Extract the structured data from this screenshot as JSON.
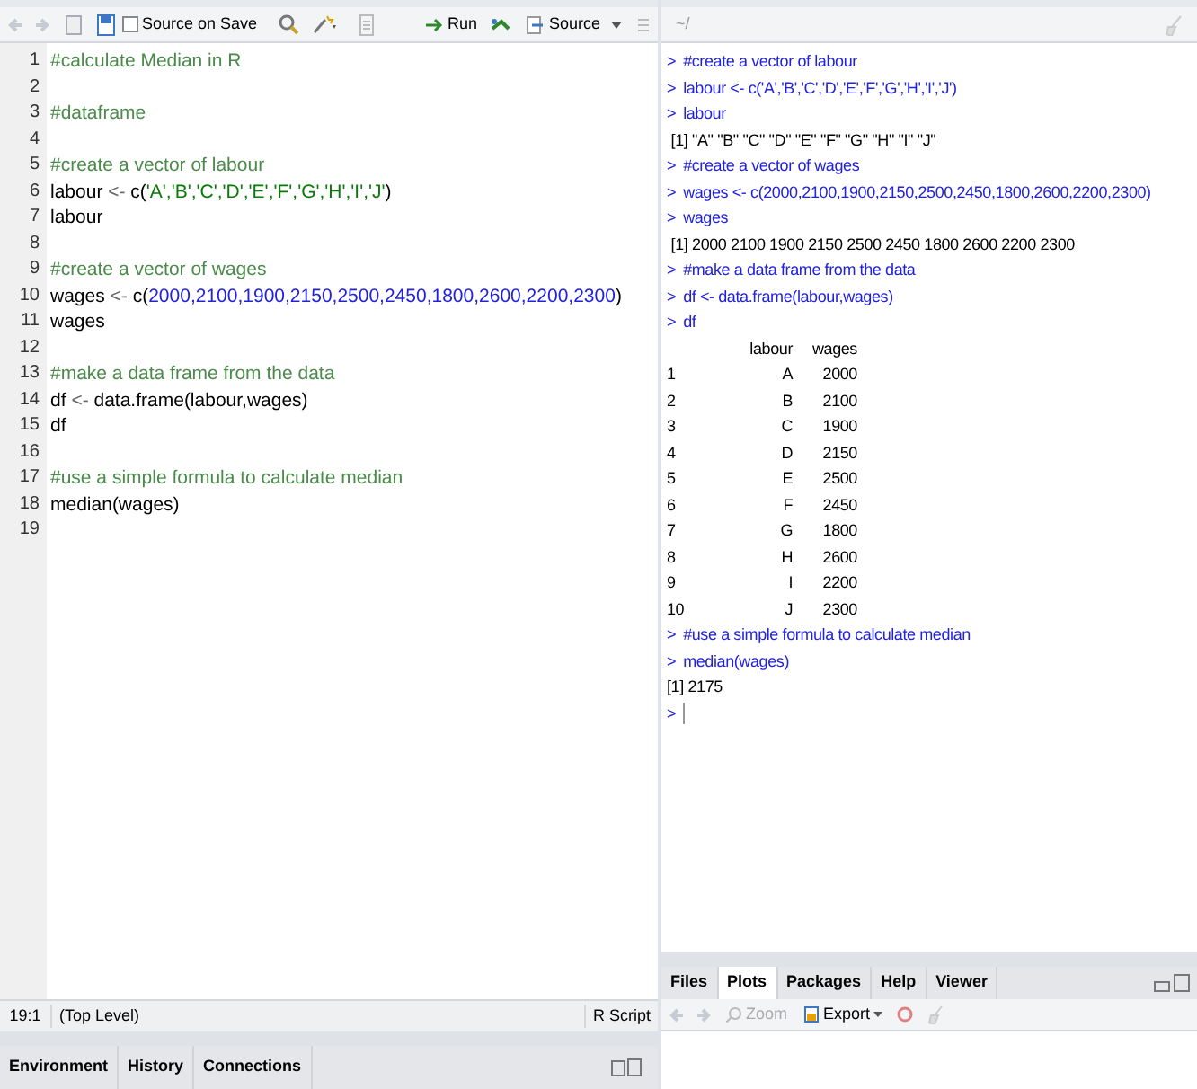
{
  "editor": {
    "toolbar": {
      "source_on_save": {
        "label": "Source on Save",
        "checked": false
      },
      "run": "Run",
      "source": "Source"
    },
    "lines": [
      {
        "number": "1",
        "tokens": [
          {
            "kind": "comment",
            "text": "#calculate Median in R"
          }
        ]
      },
      {
        "number": "2"
      },
      {
        "number": "3",
        "tokens": [
          {
            "kind": "comment",
            "text": "#dataframe"
          }
        ]
      },
      {
        "number": "4"
      },
      {
        "number": "5",
        "tokens": [
          {
            "kind": "comment",
            "text": "#create a vector of labour"
          }
        ]
      },
      {
        "number": "6",
        "tokens": [
          {
            "kind": "plain",
            "text": "labour "
          },
          {
            "kind": "operator",
            "text": "<-"
          },
          {
            "kind": "plain",
            "text": " c("
          },
          {
            "kind": "string",
            "text": "'A','B','C','D','E','F','G','H','I','J'"
          },
          {
            "kind": "plain",
            "text": ")"
          }
        ]
      },
      {
        "number": "7",
        "tokens": [
          {
            "kind": "plain",
            "text": "labour"
          }
        ]
      },
      {
        "number": "8"
      },
      {
        "number": "9",
        "tokens": [
          {
            "kind": "comment",
            "text": "#create a vector of wages"
          }
        ]
      },
      {
        "number": "10",
        "tokens": [
          {
            "kind": "plain",
            "text": "wages "
          },
          {
            "kind": "operator",
            "text": "<-"
          },
          {
            "kind": "plain",
            "text": " c("
          },
          {
            "kind": "number",
            "text": "2000,2100,1900,2150,2500,2450,1800,2600,2200,2300"
          },
          {
            "kind": "plain",
            "text": ")"
          }
        ]
      },
      {
        "number": "11",
        "tokens": [
          {
            "kind": "plain",
            "text": "wages"
          }
        ]
      },
      {
        "number": "12"
      },
      {
        "number": "13",
        "tokens": [
          {
            "kind": "comment",
            "text": "#make a data frame from the data"
          }
        ]
      },
      {
        "number": "14",
        "tokens": [
          {
            "kind": "plain",
            "text": "df "
          },
          {
            "kind": "operator",
            "text": "<-"
          },
          {
            "kind": "plain",
            "text": " data.frame(labour,wages)"
          }
        ]
      },
      {
        "number": "15",
        "tokens": [
          {
            "kind": "plain",
            "text": "df"
          }
        ]
      },
      {
        "number": "16"
      },
      {
        "number": "17",
        "tokens": [
          {
            "kind": "comment",
            "text": "#use a simple formula to calculate median"
          }
        ]
      },
      {
        "number": "18",
        "tokens": [
          {
            "kind": "plain",
            "text": "median(wages)"
          }
        ]
      },
      {
        "number": "19"
      }
    ],
    "status_bar": {
      "position": "19:1",
      "scope": "(Top Level)",
      "file_type": "R Script"
    }
  },
  "console": {
    "title": "~/",
    "lines": [
      {
        "kind": "input",
        "prompt": ">",
        "text": "#create a vector of labour"
      },
      {
        "kind": "input",
        "prompt": ">",
        "text": "labour <- c('A','B','C','D','E','F','G','H','I','J')"
      },
      {
        "kind": "input",
        "prompt": ">",
        "text": "labour"
      },
      {
        "kind": "output",
        "text": " [1] \"A\" \"B\" \"C\" \"D\" \"E\" \"F\" \"G\" \"H\" \"I\" \"J\""
      },
      {
        "kind": "input",
        "prompt": ">",
        "text": "#create a vector of wages"
      },
      {
        "kind": "input",
        "prompt": ">",
        "text": "wages <- c(2000,2100,1900,2150,2500,2450,1800,2600,2200,2300)"
      },
      {
        "kind": "input",
        "prompt": ">",
        "text": "wages"
      },
      {
        "kind": "output",
        "text": " [1] 2000 2100 1900 2150 2500 2450 1800 2600 2200 2300"
      },
      {
        "kind": "input",
        "prompt": ">",
        "text": "#make a data frame from the data"
      },
      {
        "kind": "input",
        "prompt": ">",
        "text": "df <- data.frame(labour,wages)"
      },
      {
        "kind": "input",
        "prompt": ">",
        "text": "df"
      },
      {
        "kind": "row",
        "cells": [
          "",
          "labour",
          "wages"
        ]
      },
      {
        "kind": "row",
        "cells": [
          "1",
          "A",
          "2000"
        ]
      },
      {
        "kind": "row",
        "cells": [
          "2",
          "B",
          "2100"
        ]
      },
      {
        "kind": "row",
        "cells": [
          "3",
          "C",
          "1900"
        ]
      },
      {
        "kind": "row",
        "cells": [
          "4",
          "D",
          "2150"
        ]
      },
      {
        "kind": "row",
        "cells": [
          "5",
          "E",
          "2500"
        ]
      },
      {
        "kind": "row",
        "cells": [
          "6",
          "F",
          "2450"
        ]
      },
      {
        "kind": "row",
        "cells": [
          "7",
          "G",
          "1800"
        ]
      },
      {
        "kind": "row",
        "cells": [
          "8",
          "H",
          "2600"
        ]
      },
      {
        "kind": "row",
        "cells": [
          "9",
          "I",
          "2200"
        ]
      },
      {
        "kind": "row",
        "cells": [
          "10",
          "J",
          "2300"
        ]
      },
      {
        "kind": "input",
        "prompt": ">",
        "text": "#use a simple formula to calculate median"
      },
      {
        "kind": "input",
        "prompt": ">",
        "text": "median(wages)"
      },
      {
        "kind": "output",
        "text": "[1] 2175"
      },
      {
        "kind": "input",
        "prompt": ">"
      }
    ]
  },
  "environment_tabs": [
    {
      "label": "Environment",
      "selected": false
    },
    {
      "label": "History",
      "selected": false
    },
    {
      "label": "Connections",
      "selected": false
    }
  ],
  "files_pane": {
    "tabs": [
      {
        "label": "Files",
        "selected": false
      },
      {
        "label": "Plots",
        "selected": true
      },
      {
        "label": "Packages",
        "selected": false
      },
      {
        "label": "Help",
        "selected": false
      },
      {
        "label": "Viewer",
        "selected": false
      }
    ],
    "zoom": "Zoom",
    "export": "Export"
  }
}
